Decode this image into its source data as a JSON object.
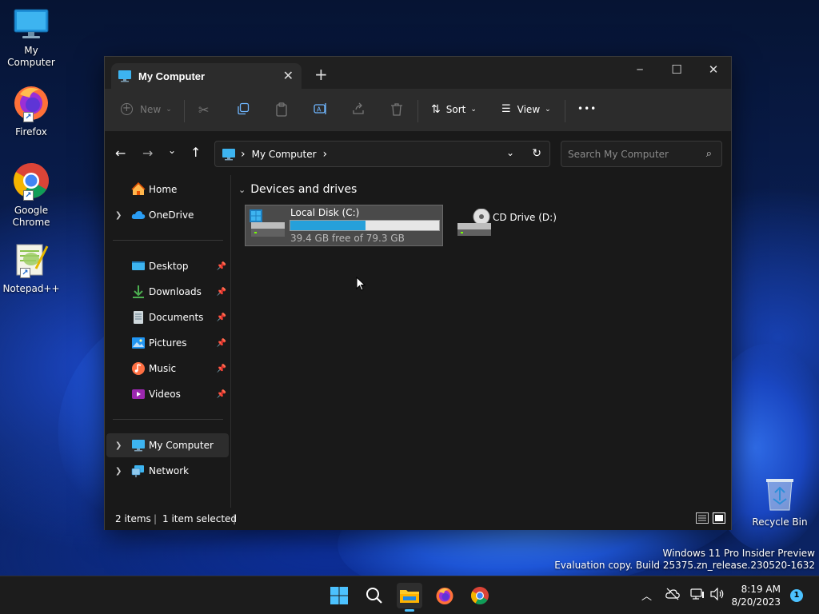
{
  "desktop": {
    "icons": [
      {
        "label": "My Computer"
      },
      {
        "label": "Firefox"
      },
      {
        "label": "Google Chrome"
      },
      {
        "label": "Notepad++"
      },
      {
        "label": "Recycle Bin"
      }
    ],
    "watermark": {
      "line1": "Windows 11 Pro Insider Preview",
      "line2": "Evaluation copy. Build 25375.zn_release.230520-1632"
    }
  },
  "window": {
    "tab_title": "My Computer",
    "tab_close": "✕",
    "new_tab": "+",
    "controls": {
      "minimize": "─",
      "maximize": "☐",
      "close": "✕"
    },
    "toolbar": {
      "new_label": "New",
      "sort_label": "Sort",
      "view_label": "View",
      "more_label": "•••"
    },
    "address": {
      "separator": "›",
      "location": "My Computer",
      "trailing_chevron": "›"
    },
    "search": {
      "placeholder": "Search My Computer"
    },
    "sidebar": {
      "items": [
        {
          "label": "Home"
        },
        {
          "label": "OneDrive"
        },
        {
          "label": "Desktop"
        },
        {
          "label": "Downloads"
        },
        {
          "label": "Documents"
        },
        {
          "label": "Pictures"
        },
        {
          "label": "Music"
        },
        {
          "label": "Videos"
        },
        {
          "label": "My Computer"
        },
        {
          "label": "Network"
        }
      ]
    },
    "content": {
      "group_header": "Devices and drives",
      "drives": [
        {
          "name": "Local Disk (C:)",
          "space": "39.4 GB free of 79.3 GB",
          "used_fraction": 0.503
        },
        {
          "name": "CD Drive (D:)"
        }
      ]
    },
    "status": {
      "items": "2 items",
      "separator": "|",
      "selected": "1 item selected",
      "trailing": "|"
    }
  },
  "taskbar": {
    "time": "8:19 AM",
    "date": "8/20/2023",
    "notification_count": "1"
  },
  "colors": {
    "accent": "#26a0da",
    "window_bg": "#191919",
    "toolbar_bg": "#2c2c2c",
    "taskbar_bg": "#1c1c1c"
  }
}
